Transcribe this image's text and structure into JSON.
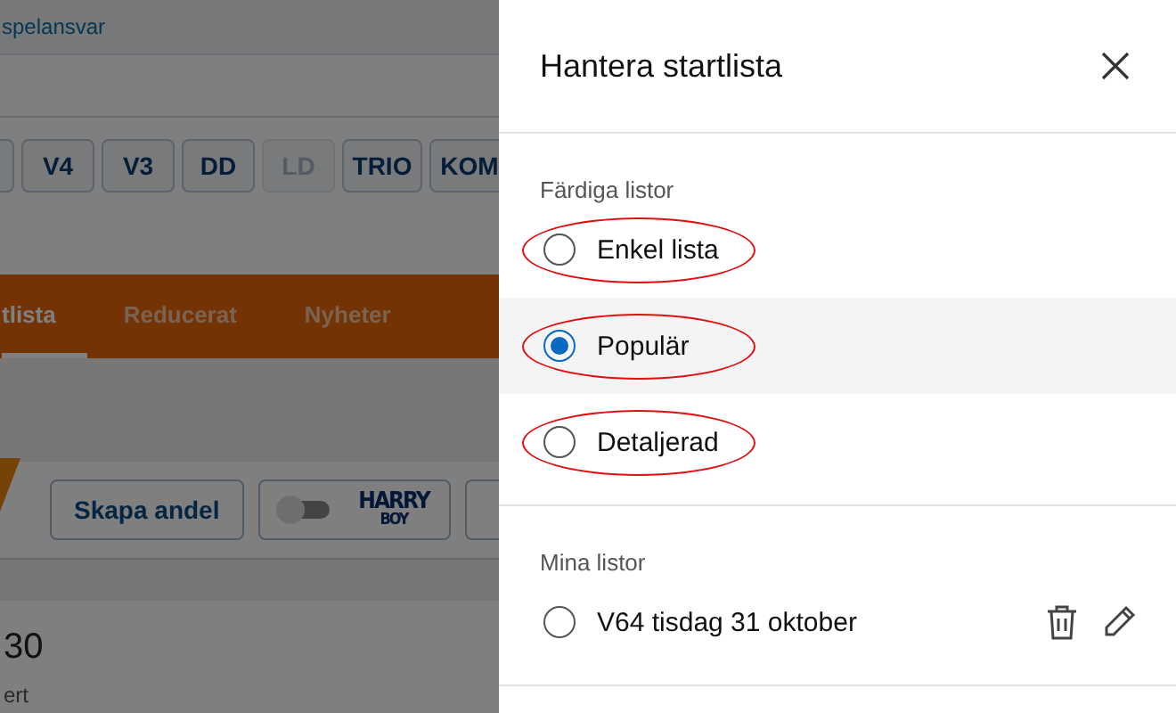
{
  "page": {
    "top_link": "spelansvar",
    "bet_types": [
      {
        "label": "V4",
        "disabled": false
      },
      {
        "label": "V3",
        "disabled": false
      },
      {
        "label": "DD",
        "disabled": false
      },
      {
        "label": "LD",
        "disabled": true
      },
      {
        "label": "TRIO",
        "disabled": false
      },
      {
        "label": "KOM",
        "disabled": false
      }
    ],
    "tabs": [
      {
        "label": "tlista",
        "selected": true
      },
      {
        "label": "Reducerat",
        "selected": false
      },
      {
        "label": "Nyheter",
        "selected": false
      }
    ],
    "create_share": "Skapa andel",
    "harry_boy": {
      "logo_top": "HARRY",
      "logo_bottom": "BOY",
      "on": false
    },
    "content": {
      "heading": "30",
      "subtext": "ert"
    }
  },
  "panel": {
    "title": "Hantera startlista",
    "sections": [
      {
        "heading": "Färdiga listor",
        "options": [
          {
            "label": "Enkel lista",
            "selected": false,
            "circled": true
          },
          {
            "label": "Populär",
            "selected": true,
            "circled": true
          },
          {
            "label": "Detaljerad",
            "selected": false,
            "circled": true
          }
        ]
      },
      {
        "heading": "Mina listor",
        "options": [
          {
            "label": "V64 tisdag 31 oktober",
            "selected": false,
            "circled": false,
            "editable": true
          }
        ]
      }
    ]
  }
}
